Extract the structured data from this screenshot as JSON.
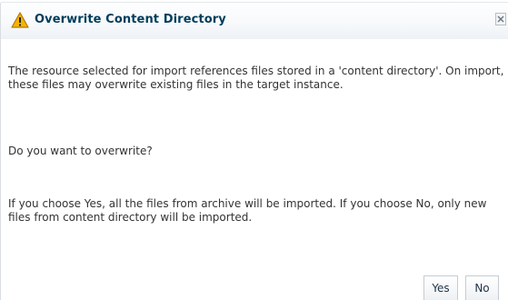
{
  "dialog": {
    "title": "Overwrite Content Directory",
    "icons": {
      "title_icon": "warning-icon",
      "close_icon": "close-icon"
    },
    "message": {
      "paragraph_1": "The resource selected for import references files stored in a 'content directory'. On import, these files may overwrite existing files in the target instance.",
      "question": "Do you want to overwrite?",
      "paragraph_2": "If you choose Yes, all the files from archive will be imported. If you choose No, only new files from content directory will be imported."
    },
    "buttons": {
      "yes_label": "Yes",
      "no_label": "No"
    }
  },
  "colors": {
    "title_text": "#003d5b",
    "body_text": "#333333",
    "warning_fill": "#f5b400",
    "warning_border": "#b37a00"
  }
}
